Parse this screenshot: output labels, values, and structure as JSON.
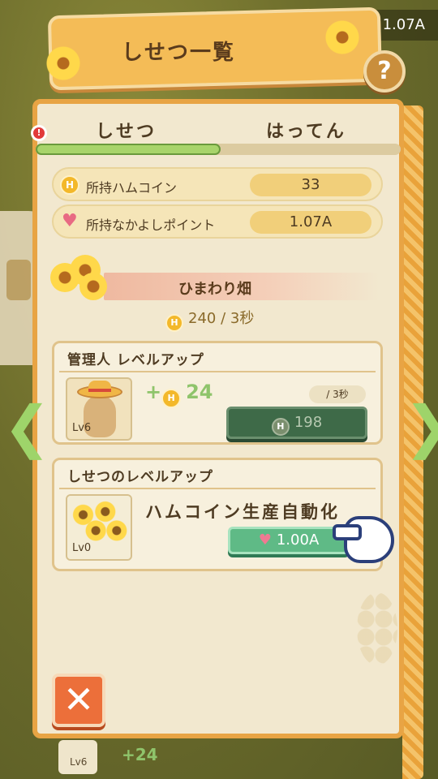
{
  "header": {
    "title": "しせつ一覧",
    "top_counter": "1.07A"
  },
  "tabs": [
    {
      "label": "しせつ",
      "active": true
    },
    {
      "label": "はってん",
      "active": false
    }
  ],
  "alert_badge": "!",
  "stats": {
    "hamcoin": {
      "label": "所持ハムコイン",
      "value": "33"
    },
    "friendship": {
      "label": "所持なかよしポイント",
      "value": "1.07A"
    }
  },
  "facility": {
    "name": "ひまわり畑",
    "rate": "240 / 3秒"
  },
  "manager_card": {
    "title": "管理人 レベルアップ",
    "level": "Lv6",
    "bonus": "+",
    "bonus_value": "24",
    "per_sec": "/ 3秒",
    "cost": "198"
  },
  "facility_card": {
    "title": "しせつのレベルアップ",
    "level": "Lv0",
    "action_label": "ハムコイン生産自動化",
    "cost": "1.00A"
  },
  "background": {
    "item_level": "Lv6",
    "item_bonus": "+",
    "item_bonus_value": "24"
  },
  "icons": {
    "coin": "H",
    "heart": "♥",
    "close": "✕",
    "help": "?",
    "arrow_left": "❮",
    "arrow_right": "❯"
  },
  "colors": {
    "accent": "#e8a444",
    "button_green": "#5fba86",
    "button_disabled": "#3e6a48",
    "close": "#ec6f3a"
  }
}
